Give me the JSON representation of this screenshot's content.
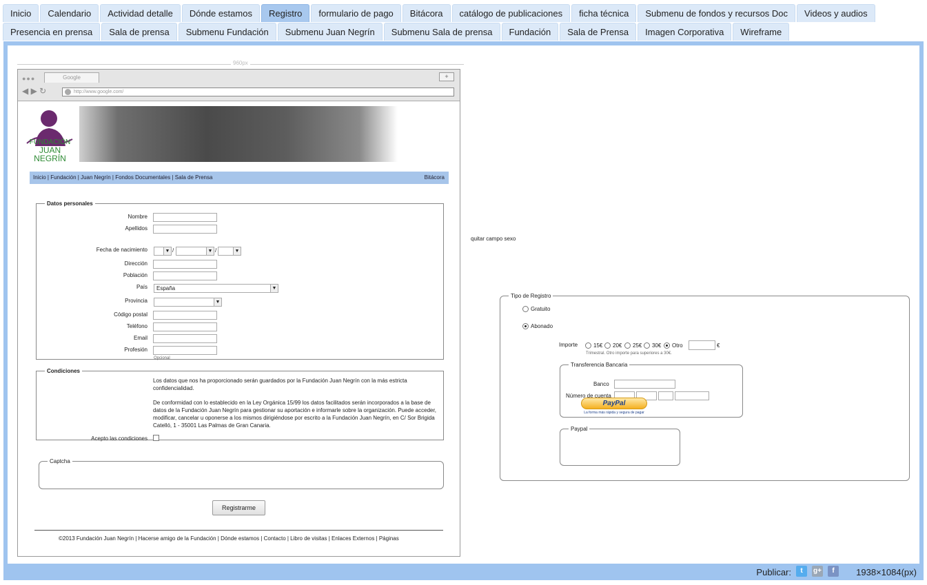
{
  "tabs_row1": [
    "Inicio",
    "Calendario",
    "Actividad detalle",
    "Dónde estamos",
    "Registro",
    "formulario de pago",
    "Bitácora",
    "catálogo de publicaciones",
    "ficha técnica",
    "Submenu de fondos y recursos Doc",
    "Videos y audios"
  ],
  "tabs_row2": [
    "Presencia en prensa",
    "Sala de prensa",
    "Submenu Fundación",
    "Submenu Juan Negrín",
    "Submenu Sala de prensa",
    "Fundación",
    "Sala de Prensa",
    "Imagen Corporativa",
    "Wireframe"
  ],
  "active_tab": "Registro",
  "ruler_label": "960px",
  "browser": {
    "tab_title": "Google",
    "plus": "+",
    "url": "http://www.google.com/"
  },
  "logo": {
    "line1": "FUNDACIÓN",
    "line2": "JUAN NEGRÍN"
  },
  "site_nav": {
    "links": "Inicio | Fundación | Juan Negrín | Fondos Documentales | Sala de Prensa",
    "right": "Bitácora"
  },
  "datos": {
    "legend": "Datos personales",
    "nombre": "Nombre",
    "apellidos": "Apellidos",
    "fecha": "Fecha de nacimiento",
    "slash": "/",
    "direccion": "Dirección",
    "poblacion": "Población",
    "pais": "País",
    "pais_value": "España",
    "provincia": "Provincia",
    "cp": "Código postal",
    "telefono": "Teléfono",
    "email": "Email",
    "profesion": "Profesión",
    "opcional": "Opcional"
  },
  "condiciones": {
    "legend": "Condiciones",
    "p1a": "Los datos que nos ha proporcionado serán guardados por la Fundación Juan Negrín con la más estricta",
    "p1b": "confidencialidad.",
    "p2a": "De conformidad con lo establecido en la Ley Orgánica 15/99 los datos facilitados serán incorporados a la base de",
    "p2b": "datos de la Fundación Juan Negrín para gestionar su aportación e informarle sobre la organización. Puede acceder,",
    "p2c": "modificar, cancelar u oponerse a los mismos dirigiéndose por escrito a la Fundación Juan Negrín, en C/ Sor Brigida",
    "p2d": "Catelló, 1 - 35001 Las Palmas de Gran Canaria.",
    "acepto": "Acepto las condiciones"
  },
  "captcha": {
    "legend": "Captcha"
  },
  "submit": "Registrarme",
  "footer": "©2013 Fundación Juan Negrín | Hacerse amigo de la Fundación | Dónde estamos | Contacto | Libro de visitas | Enlaces Externos | Páginas",
  "note": "quitar campo sexo",
  "registro": {
    "legend": "Tipo de Registro",
    "gratuito": "Gratuito",
    "abonado": "Abonado",
    "importe": "Importe",
    "amounts": [
      "15€",
      "20€",
      "25€",
      "30€",
      "Otro"
    ],
    "selected_amount": "Otro",
    "euro": "€",
    "hint": "Trimestral. Otro importe para superiores a 30€.",
    "transfer_legend": "Transferencia Bancaria",
    "banco": "Banco",
    "cuenta": "Número de cuenta",
    "paypal_legend": "Paypal",
    "paypal_btn": "PayPal",
    "paypal_small": "La forma más rápida y segura de pagar"
  },
  "bottom": {
    "publicar": "Publicar:",
    "dims": "1938×1084(px)",
    "social": [
      "t",
      "g+",
      "f"
    ]
  }
}
